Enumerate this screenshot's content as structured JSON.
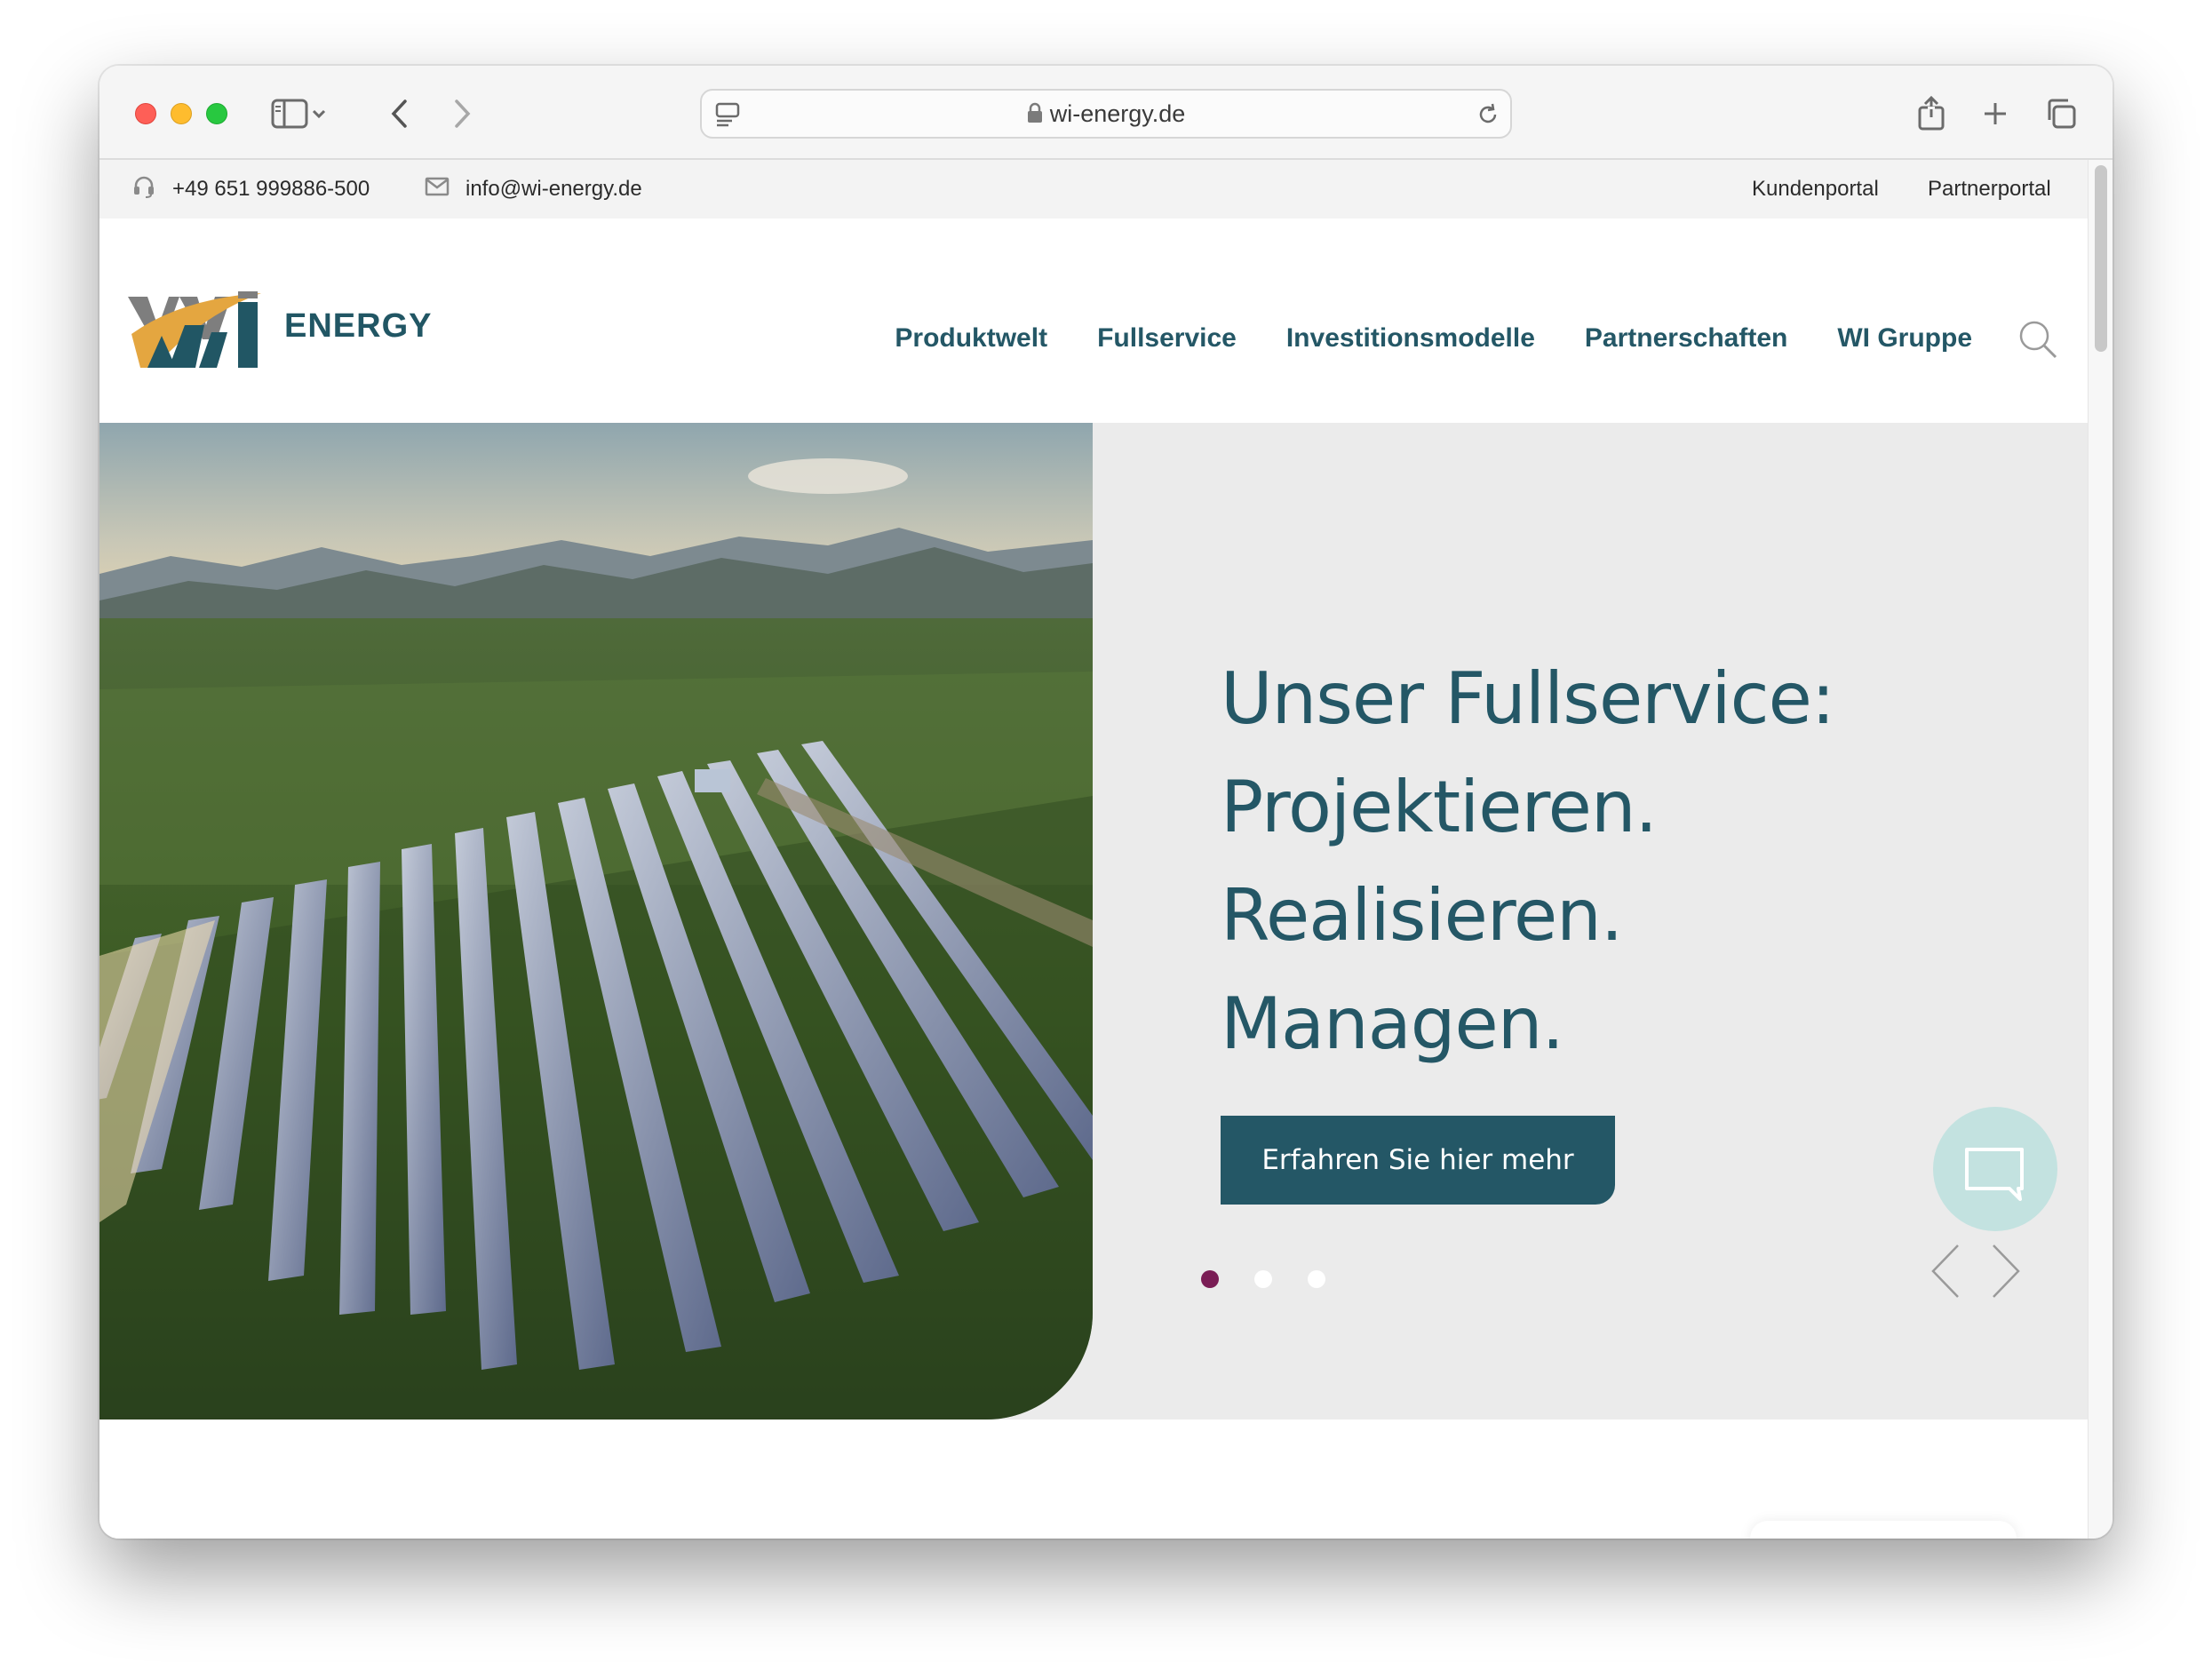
{
  "browser": {
    "url": "wi-energy.de"
  },
  "topbar": {
    "phone": "+49 651 999886-500",
    "email": "info@wi-energy.de",
    "links": [
      "Kundenportal",
      "Partnerportal"
    ]
  },
  "header": {
    "logo_text": "ENERGY",
    "nav": [
      "Produktwelt",
      "Fullservice",
      "Investitionsmodelle",
      "Partnerschaften",
      "WI Gruppe"
    ]
  },
  "hero": {
    "lines": [
      "Unser Fullservice:",
      "Projektieren.",
      "Realisieren.",
      "Managen."
    ],
    "cta": "Erfahren Sie hier mehr",
    "slides_total": 3,
    "active_slide": 1
  },
  "colors": {
    "brand": "#245766",
    "accent": "#7a1d55",
    "hero_bg": "#ebebeb",
    "chat": "#c3e2e0"
  },
  "icons": [
    "sidebar-icon",
    "chevron-down-icon",
    "back-icon",
    "forward-icon",
    "page-settings-icon",
    "lock-icon",
    "reload-icon",
    "share-icon",
    "new-tab-icon",
    "tabs-overview-icon",
    "headset-icon",
    "mail-icon",
    "search-icon",
    "chat-icon",
    "prev-arrow-icon",
    "next-arrow-icon"
  ]
}
